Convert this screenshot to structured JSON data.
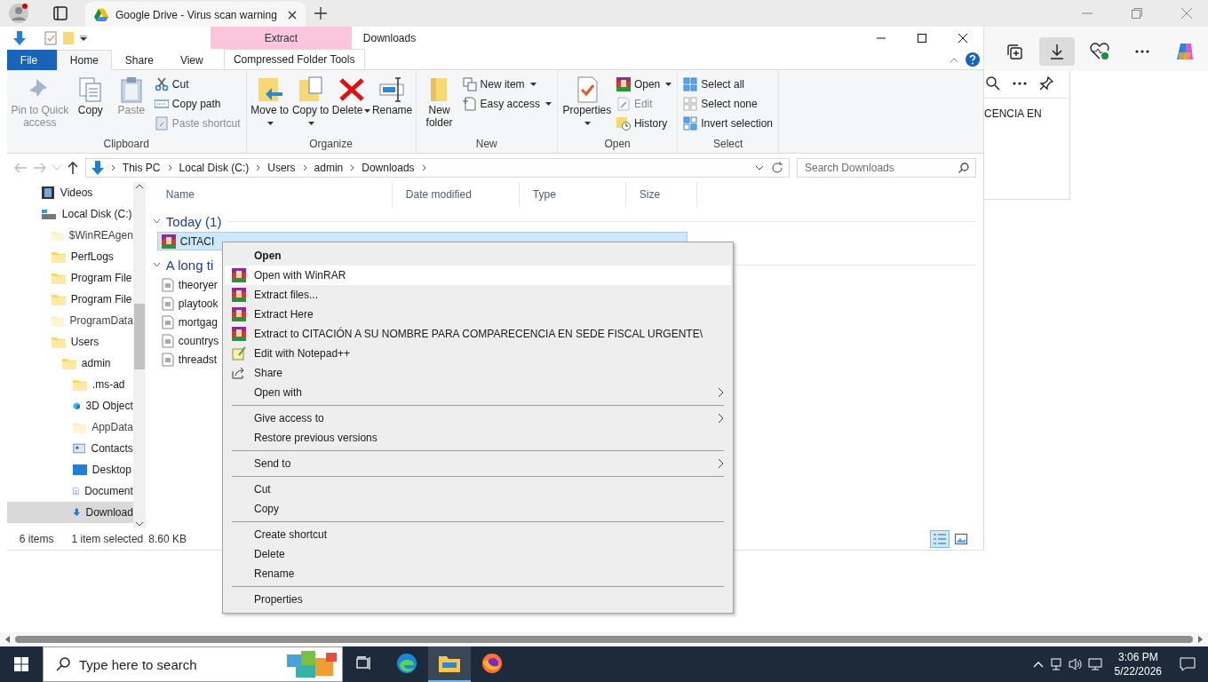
{
  "browser": {
    "tab": {
      "title": "Google Drive - Virus scan warning"
    },
    "panel_text": "CENCIA EN"
  },
  "explorer": {
    "title": "Downloads",
    "context_tab": {
      "label": "Extract",
      "group": "Compressed Folder Tools"
    },
    "ribbon_tabs": [
      {
        "label": "File",
        "selected": false
      },
      {
        "label": "Home",
        "selected": true
      },
      {
        "label": "Share",
        "selected": false
      },
      {
        "label": "View",
        "selected": false
      }
    ],
    "ribbon": [
      {
        "label": "Clipboard",
        "large": [
          {
            "label": "Pin to Quick access",
            "disabled": true,
            "dropdown": false
          },
          {
            "label": "Copy",
            "disabled": false,
            "dropdown": false
          },
          {
            "label": "Paste",
            "disabled": true,
            "dropdown": false
          }
        ],
        "small": [
          {
            "label": "Cut",
            "disabled": false,
            "dropdown": false
          },
          {
            "label": "Copy path",
            "disabled": false,
            "dropdown": false
          },
          {
            "label": "Paste shortcut",
            "disabled": true,
            "dropdown": false
          }
        ]
      },
      {
        "label": "Organize",
        "large": [
          {
            "label": "Move to",
            "disabled": false,
            "dropdown": true
          },
          {
            "label": "Copy to",
            "disabled": false,
            "dropdown": true
          },
          {
            "label": "Delete",
            "disabled": false,
            "dropdown": true
          },
          {
            "label": "Rename",
            "disabled": false,
            "dropdown": false
          }
        ]
      },
      {
        "label": "New",
        "large": [
          {
            "label": "New folder",
            "disabled": false,
            "dropdown": false
          }
        ],
        "small": [
          {
            "label": "New item",
            "disabled": false,
            "dropdown": true
          },
          {
            "label": "Easy access",
            "disabled": false,
            "dropdown": true
          }
        ]
      },
      {
        "label": "Open",
        "large": [
          {
            "label": "Properties",
            "disabled": false,
            "dropdown": true
          }
        ],
        "small": [
          {
            "label": "Open",
            "disabled": false,
            "dropdown": true
          },
          {
            "label": "Edit",
            "disabled": true,
            "dropdown": false
          },
          {
            "label": "History",
            "disabled": false,
            "dropdown": false
          }
        ]
      },
      {
        "label": "Select",
        "small": [
          {
            "label": "Select all",
            "disabled": false,
            "dropdown": false
          },
          {
            "label": "Select none",
            "disabled": false,
            "dropdown": false
          },
          {
            "label": "Invert selection",
            "disabled": false,
            "dropdown": false
          }
        ]
      }
    ],
    "breadcrumbs": [
      "This PC",
      "Local Disk (C:)",
      "Users",
      "admin",
      "Downloads"
    ],
    "search": {
      "placeholder": "Search Downloads"
    },
    "nav": [
      {
        "label": "Videos",
        "hidden": false,
        "selected": false
      },
      {
        "label": "Local Disk (C:)",
        "hidden": false,
        "selected": false,
        "children": [
          {
            "label": "$WinREAgen",
            "hidden": true,
            "selected": false
          },
          {
            "label": "PerfLogs",
            "hidden": false,
            "selected": false
          },
          {
            "label": "Program File",
            "hidden": false,
            "selected": false
          },
          {
            "label": "Program File",
            "hidden": false,
            "selected": false
          },
          {
            "label": "ProgramData",
            "hidden": true,
            "selected": false
          },
          {
            "label": "Users",
            "hidden": false,
            "selected": false,
            "children": [
              {
                "label": "admin",
                "hidden": false,
                "selected": false,
                "children": [
                  {
                    "label": ".ms-ad",
                    "hidden": false,
                    "selected": false
                  },
                  {
                    "label": "3D Object",
                    "hidden": false,
                    "selected": false
                  },
                  {
                    "label": "AppData",
                    "hidden": true,
                    "selected": false
                  },
                  {
                    "label": "Contacts",
                    "hidden": false,
                    "selected": false
                  },
                  {
                    "label": "Desktop",
                    "hidden": false,
                    "selected": false
                  },
                  {
                    "label": "Document",
                    "hidden": false,
                    "selected": false
                  },
                  {
                    "label": "Download",
                    "hidden": false,
                    "selected": true
                  }
                ]
              }
            ]
          }
        ]
      }
    ],
    "columns": [
      "Name",
      "Date modified",
      "Type",
      "Size"
    ],
    "groups": [
      {
        "label": "Today (1)",
        "expanded": true,
        "files": [
          {
            "name": "CITACI",
            "kind": "archive",
            "selected": true
          }
        ]
      },
      {
        "label": "A long ti",
        "expanded": true,
        "files": [
          {
            "name": "theoryer",
            "kind": "text",
            "selected": false
          },
          {
            "name": "playtook",
            "kind": "text",
            "selected": false
          },
          {
            "name": "mortgag",
            "kind": "text",
            "selected": false
          },
          {
            "name": "countrys",
            "kind": "text",
            "selected": false
          },
          {
            "name": "threadst",
            "kind": "text",
            "selected": false
          }
        ]
      }
    ],
    "status": {
      "count": "6 items",
      "selection": "1 item selected",
      "size": "8.60 KB"
    },
    "views": [
      {
        "selected": true
      },
      {
        "selected": false
      }
    ]
  },
  "context_menu": [
    [
      {
        "label": "Open",
        "default": true,
        "selected": false,
        "submenu": false
      },
      {
        "label": "Open with WinRAR",
        "default": false,
        "selected": true,
        "submenu": false
      },
      {
        "label": "Extract files...",
        "default": false,
        "selected": false,
        "submenu": false
      },
      {
        "label": "Extract Here",
        "default": false,
        "selected": false,
        "submenu": false
      },
      {
        "label": "Extract to CITACIÓN A SU NOMBRE PARA COMPARECENCIA EN SEDE FISCAL URGENTE\\",
        "default": false,
        "selected": false,
        "submenu": false
      },
      {
        "label": "Edit with Notepad++",
        "default": false,
        "selected": false,
        "submenu": false
      },
      {
        "label": "Share",
        "default": false,
        "selected": false,
        "submenu": false
      },
      {
        "label": "Open with",
        "default": false,
        "selected": false,
        "submenu": true
      }
    ],
    [
      {
        "label": "Give access to",
        "default": false,
        "selected": false,
        "submenu": true
      },
      {
        "label": "Restore previous versions",
        "default": false,
        "selected": false,
        "submenu": false
      }
    ],
    [
      {
        "label": "Send to",
        "default": false,
        "selected": false,
        "submenu": true
      }
    ],
    [
      {
        "label": "Cut",
        "default": false,
        "selected": false,
        "submenu": false
      },
      {
        "label": "Copy",
        "default": false,
        "selected": false,
        "submenu": false
      }
    ],
    [
      {
        "label": "Create shortcut",
        "default": false,
        "selected": false,
        "submenu": false
      },
      {
        "label": "Delete",
        "default": false,
        "selected": false,
        "submenu": false
      },
      {
        "label": "Rename",
        "default": false,
        "selected": false,
        "submenu": false
      }
    ],
    [
      {
        "label": "Properties",
        "default": false,
        "selected": false,
        "submenu": false
      }
    ]
  ],
  "taskbar": {
    "search_placeholder": "Type here to search",
    "apps": [
      {
        "selected": false
      },
      {
        "selected": false
      },
      {
        "selected": true
      },
      {
        "selected": false
      }
    ],
    "time": "3:06 PM",
    "date": "5/22/2026"
  }
}
